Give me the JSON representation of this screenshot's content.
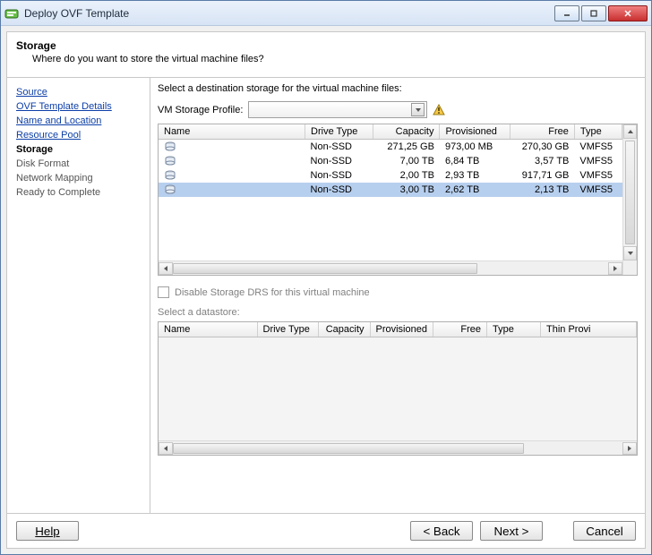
{
  "window": {
    "title": "Deploy OVF Template"
  },
  "header": {
    "title": "Storage",
    "subtitle": "Where do you want to store the virtual machine files?"
  },
  "steps": {
    "items": [
      {
        "label": "Source",
        "state": "link"
      },
      {
        "label": "OVF Template Details",
        "state": "link"
      },
      {
        "label": "Name and Location",
        "state": "link"
      },
      {
        "label": "Resource Pool",
        "state": "link"
      },
      {
        "label": "Storage",
        "state": "current"
      },
      {
        "label": "Disk Format",
        "state": "other"
      },
      {
        "label": "Network Mapping",
        "state": "other"
      },
      {
        "label": "Ready to Complete",
        "state": "other"
      }
    ]
  },
  "main": {
    "prompt": "Select a destination storage for the virtual machine files:",
    "profile_label": "VM Storage Profile:",
    "profile_selected": "",
    "columns": {
      "name": "Name",
      "drive_type": "Drive Type",
      "capacity": "Capacity",
      "provisioned": "Provisioned",
      "free": "Free",
      "type": "Type"
    },
    "rows": [
      {
        "name": "",
        "drive_type": "Non-SSD",
        "capacity": "271,25 GB",
        "provisioned": "973,00 MB",
        "free": "270,30 GB",
        "type": "VMFS5",
        "selected": false
      },
      {
        "name": "",
        "drive_type": "Non-SSD",
        "capacity": "7,00 TB",
        "provisioned": "6,84 TB",
        "free": "3,57 TB",
        "type": "VMFS5",
        "selected": false
      },
      {
        "name": "",
        "drive_type": "Non-SSD",
        "capacity": "2,00 TB",
        "provisioned": "2,93 TB",
        "free": "917,71 GB",
        "type": "VMFS5",
        "selected": false
      },
      {
        "name": "",
        "drive_type": "Non-SSD",
        "capacity": "3,00 TB",
        "provisioned": "2,62 TB",
        "free": "2,13 TB",
        "type": "VMFS5",
        "selected": true
      }
    ],
    "disable_drs_label": "Disable Storage DRS for this virtual machine",
    "select_datastore_label": "Select a datastore:",
    "ds_columns": {
      "name": "Name",
      "drive_type": "Drive Type",
      "capacity": "Capacity",
      "provisioned": "Provisioned",
      "free": "Free",
      "type": "Type",
      "thin": "Thin Provi"
    }
  },
  "footer": {
    "help": "Help",
    "back": "< Back",
    "next": "Next >",
    "cancel": "Cancel"
  }
}
